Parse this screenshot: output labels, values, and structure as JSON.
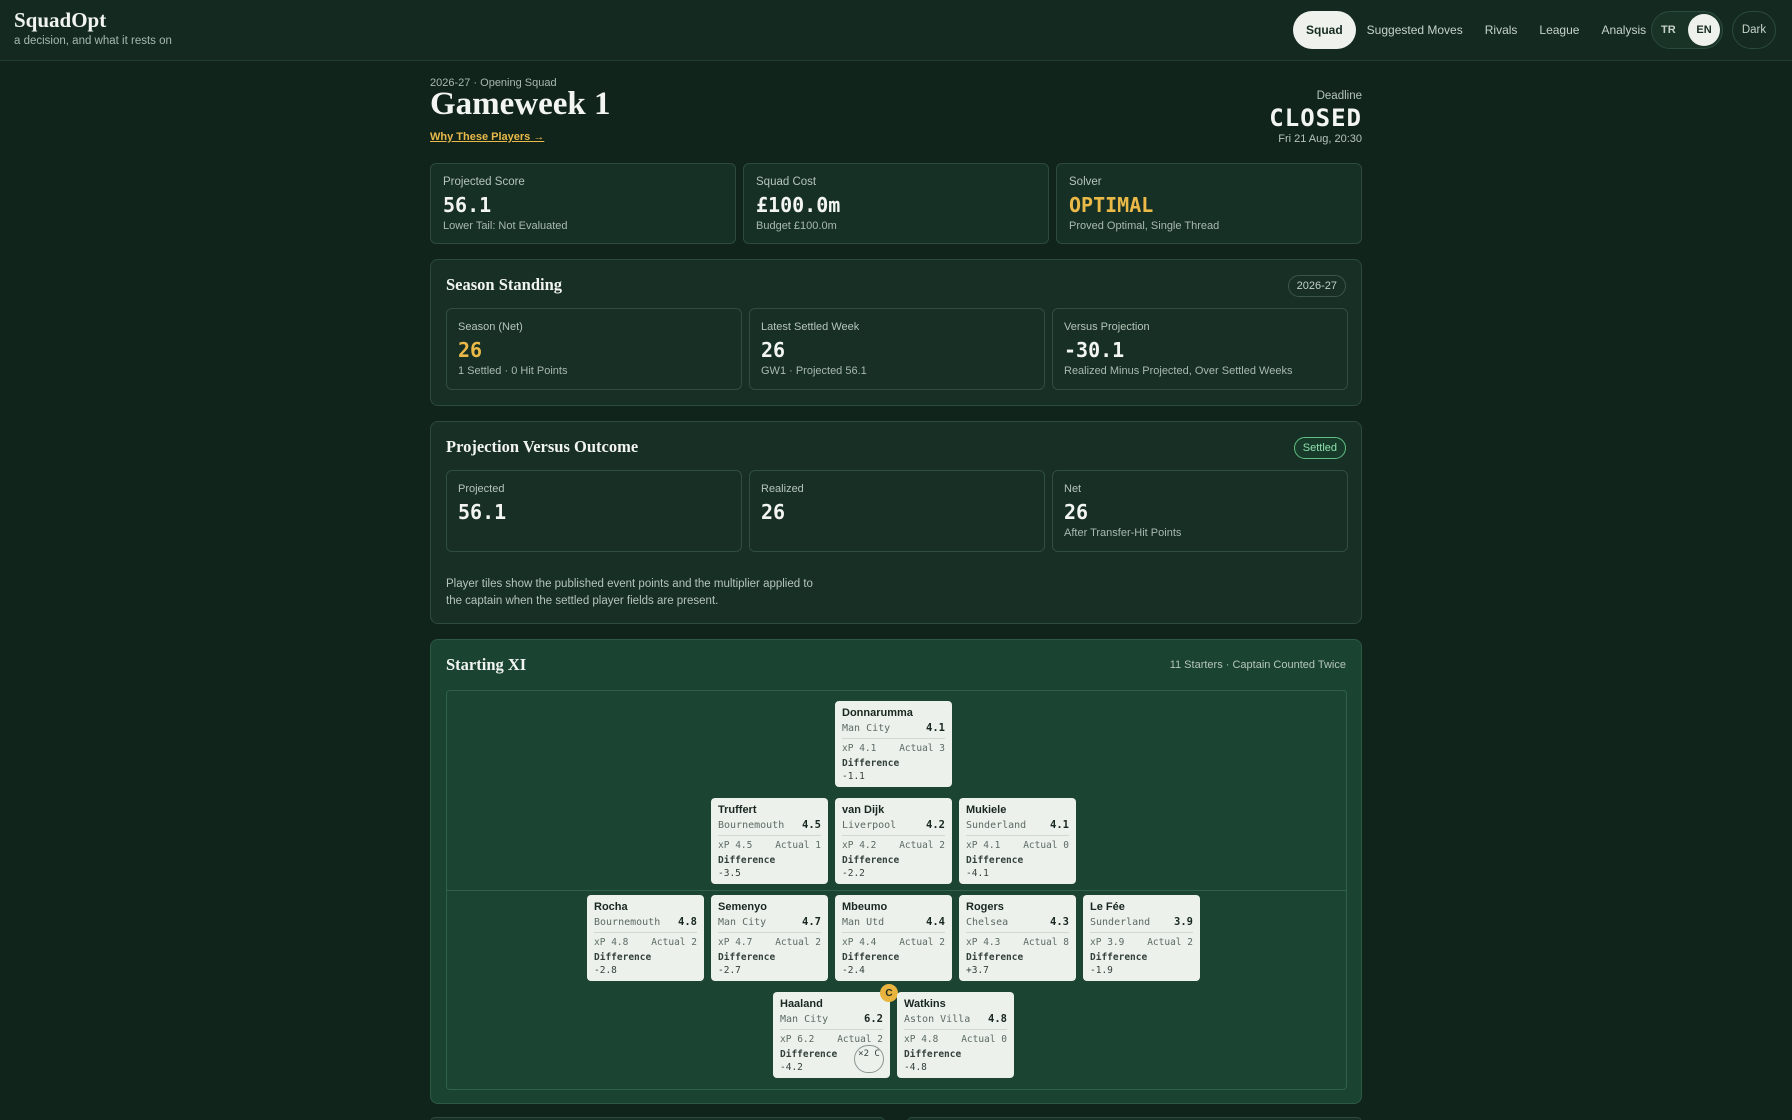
{
  "brand": {
    "name": "SquadOpt",
    "tagline": "a decision, and what it rests on"
  },
  "nav": {
    "items": [
      "Squad",
      "Suggested Moves",
      "Rivals",
      "League",
      "Analysis"
    ],
    "active": "Squad"
  },
  "lang": {
    "options": [
      "TR",
      "EN"
    ],
    "selected": "EN"
  },
  "theme": {
    "label": "Dark"
  },
  "header": {
    "season_label": "2026-27 · Opening Squad",
    "title": "Gameweek 1",
    "link": "Why These Players →",
    "deadline_label": "Deadline",
    "deadline_status": "CLOSED",
    "deadline_date": "Fri 21 Aug, 20:30"
  },
  "stats": [
    {
      "label": "Projected Score",
      "value": "56.1",
      "sub": "Lower Tail: Not Evaluated"
    },
    {
      "label": "Squad Cost",
      "value": "£100.0m",
      "sub": "Budget £100.0m"
    },
    {
      "label": "Solver",
      "value": "OPTIMAL",
      "sub": "Proved Optimal, Single Thread"
    }
  ],
  "season_standing": {
    "title": "Season Standing",
    "badge": "2026-27",
    "cards": [
      {
        "label": "Season (Net)",
        "value": "26",
        "sub": "1 Settled · 0 Hit Points"
      },
      {
        "label": "Latest Settled Week",
        "value": "26",
        "sub": "GW1 · Projected 56.1"
      },
      {
        "label": "Versus Projection",
        "value": "-30.1",
        "sub": "Realized Minus Projected, Over Settled Weeks"
      }
    ]
  },
  "projection": {
    "title": "Projection Versus Outcome",
    "badge": "Settled",
    "cards": [
      {
        "label": "Projected",
        "value": "56.1",
        "sub": ""
      },
      {
        "label": "Realized",
        "value": "26",
        "sub": ""
      },
      {
        "label": "Net",
        "value": "26",
        "sub": "After Transfer-Hit Points"
      }
    ],
    "note": "Player tiles show the published event points and the multiplier applied to the captain when the settled player fields are present."
  },
  "starting_xi": {
    "title": "Starting XI",
    "meta": "11 Starters · Captain Counted Twice",
    "labels": {
      "xp_prefix": "xP",
      "actual_prefix": "Actual",
      "difference": "Difference",
      "captain_badge": "C",
      "captain_multiplier": "×2 C"
    },
    "players": [
      {
        "name": "Donnarumma",
        "club": "Man City",
        "xp": "4.1",
        "actual": "3",
        "diff": "-1.1"
      },
      {
        "name": "Truffert",
        "club": "Bournemouth",
        "xp": "4.5",
        "actual": "1",
        "diff": "-3.5"
      },
      {
        "name": "van Dijk",
        "club": "Liverpool",
        "xp": "4.2",
        "actual": "2",
        "diff": "-2.2"
      },
      {
        "name": "Mukiele",
        "club": "Sunderland",
        "xp": "4.1",
        "actual": "0",
        "diff": "-4.1"
      },
      {
        "name": "Rocha",
        "club": "Bournemouth",
        "xp": "4.8",
        "actual": "2",
        "diff": "-2.8"
      },
      {
        "name": "Semenyo",
        "club": "Man City",
        "xp": "4.7",
        "actual": "2",
        "diff": "-2.7"
      },
      {
        "name": "Mbeumo",
        "club": "Man Utd",
        "xp": "4.4",
        "actual": "2",
        "diff": "-2.4"
      },
      {
        "name": "Rogers",
        "club": "Chelsea",
        "xp": "4.3",
        "actual": "8",
        "diff": "+3.7"
      },
      {
        "name": "Le Fée",
        "club": "Sunderland",
        "xp": "3.9",
        "actual": "2",
        "diff": "-1.9"
      },
      {
        "name": "Haaland",
        "club": "Man City",
        "xp": "6.2",
        "actual": "2",
        "diff": "-4.2",
        "captain": true
      },
      {
        "name": "Watkins",
        "club": "Aston Villa",
        "xp": "4.8",
        "actual": "0",
        "diff": "-4.8"
      }
    ]
  }
}
